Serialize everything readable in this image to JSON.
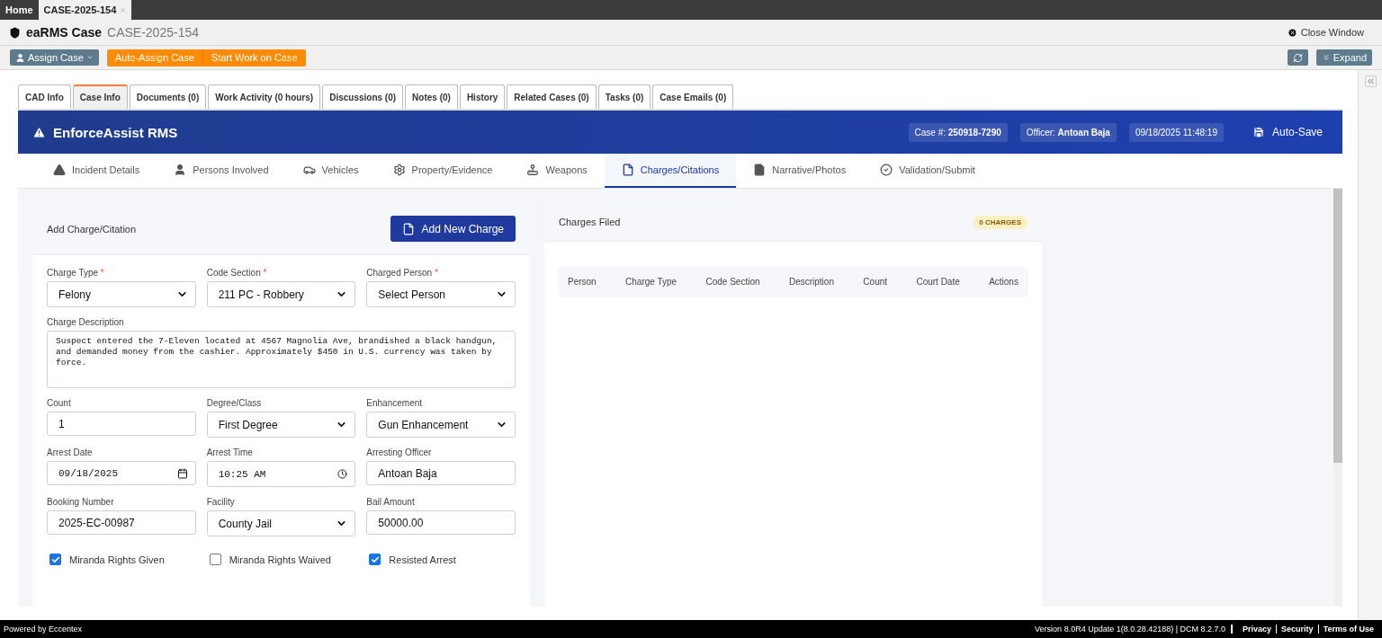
{
  "browser_tabs": [
    {
      "label": "Home",
      "selected": false
    },
    {
      "label": "CASE-2025-154",
      "selected": true
    }
  ],
  "header": {
    "title": "eaRMS Case",
    "case_id": "CASE-2025-154",
    "close": "Close Window"
  },
  "toolbar": {
    "assign": "Assign Case",
    "actions": [
      "Auto-Assign Case",
      "Start Work on Case"
    ],
    "expand": "Expand"
  },
  "case_tabs": [
    {
      "label": "CAD Info",
      "selected": false
    },
    {
      "label": "Case Info",
      "selected": true
    },
    {
      "label": "Documents (0)",
      "selected": false
    },
    {
      "label": "Work Activity (0 hours)",
      "selected": false
    },
    {
      "label": "Discussions (0)",
      "selected": false
    },
    {
      "label": "Notes (0)",
      "selected": false
    },
    {
      "label": "History",
      "selected": false
    },
    {
      "label": "Related Cases (0)",
      "selected": false
    },
    {
      "label": "Tasks (0)",
      "selected": false
    },
    {
      "label": "Case Emails (0)",
      "selected": false
    }
  ],
  "app": {
    "name": "EnforceAssist RMS",
    "case_label": "Case #:",
    "case_number": "250918-7290",
    "officer_label": "Officer:",
    "officer": "Antoan Baja",
    "datetime": "09/18/2025 11:48:19",
    "autosave": "Auto-Save"
  },
  "nav_tabs": [
    {
      "label": "Incident Details",
      "selected": false
    },
    {
      "label": "Persons Involved",
      "selected": false
    },
    {
      "label": "Vehicles",
      "selected": false
    },
    {
      "label": "Property/Evidence",
      "selected": false
    },
    {
      "label": "Weapons",
      "selected": false
    },
    {
      "label": "Charges/Citations",
      "selected": true
    },
    {
      "label": "Narrative/Photos",
      "selected": false
    },
    {
      "label": "Validation/Submit",
      "selected": false
    }
  ],
  "form": {
    "title": "Add Charge/Citation",
    "add_button": "Add New Charge",
    "fields": [
      {
        "label": "Charge Type",
        "marker": "*",
        "kind": "select",
        "value": "Felony"
      },
      {
        "label": "Code Section",
        "marker": "*",
        "kind": "select",
        "value": "211 PC - Robbery"
      },
      {
        "label": "Charged Person",
        "marker": "*",
        "kind": "select",
        "value": "Select Person"
      },
      {
        "label": "Charge Description",
        "kind": "textarea",
        "value": "Suspect entered the 7-Eleven located at 4567 Magnolia Ave, brandished a black handgun, and demanded money from the cashier. Approximately $450 in U.S. currency was taken by force."
      },
      {
        "label": "Count",
        "kind": "input",
        "value": "1"
      },
      {
        "label": "Degree/Class",
        "kind": "select",
        "value": "First Degree"
      },
      {
        "label": "Enhancement",
        "kind": "select",
        "value": "Gun Enhancement"
      },
      {
        "label": "Arrest Date",
        "kind": "date",
        "value": "09/18/2025"
      },
      {
        "label": "Arrest Time",
        "kind": "time",
        "value": "10:25 AM"
      },
      {
        "label": "Arresting Officer",
        "kind": "input",
        "value": "Antoan Baja"
      },
      {
        "label": "Booking Number",
        "kind": "input",
        "value": "2025-EC-00987"
      },
      {
        "label": "Facility",
        "kind": "select",
        "value": "County Jail"
      },
      {
        "label": "Bail Amount",
        "kind": "input",
        "value": "50000.00"
      }
    ],
    "checkboxes": [
      {
        "label": "Miranda Rights Given",
        "checked": true
      },
      {
        "label": "Miranda Rights Waived",
        "checked": false
      },
      {
        "label": "Resisted Arrest",
        "checked": true
      }
    ]
  },
  "charges": {
    "title": "Charges Filed",
    "badge": "0 CHARGES",
    "columns": [
      "Person",
      "Charge Type",
      "Code Section",
      "Description",
      "Count",
      "Court Date",
      "Actions"
    ]
  },
  "footer": {
    "powered": "Powered by Eccentex",
    "version": "Version  8.0R4 Update 1(8.0.28.42188) | DCM 8.2.7.0",
    "links": [
      "Privacy",
      "Security",
      "Terms of Use"
    ]
  }
}
